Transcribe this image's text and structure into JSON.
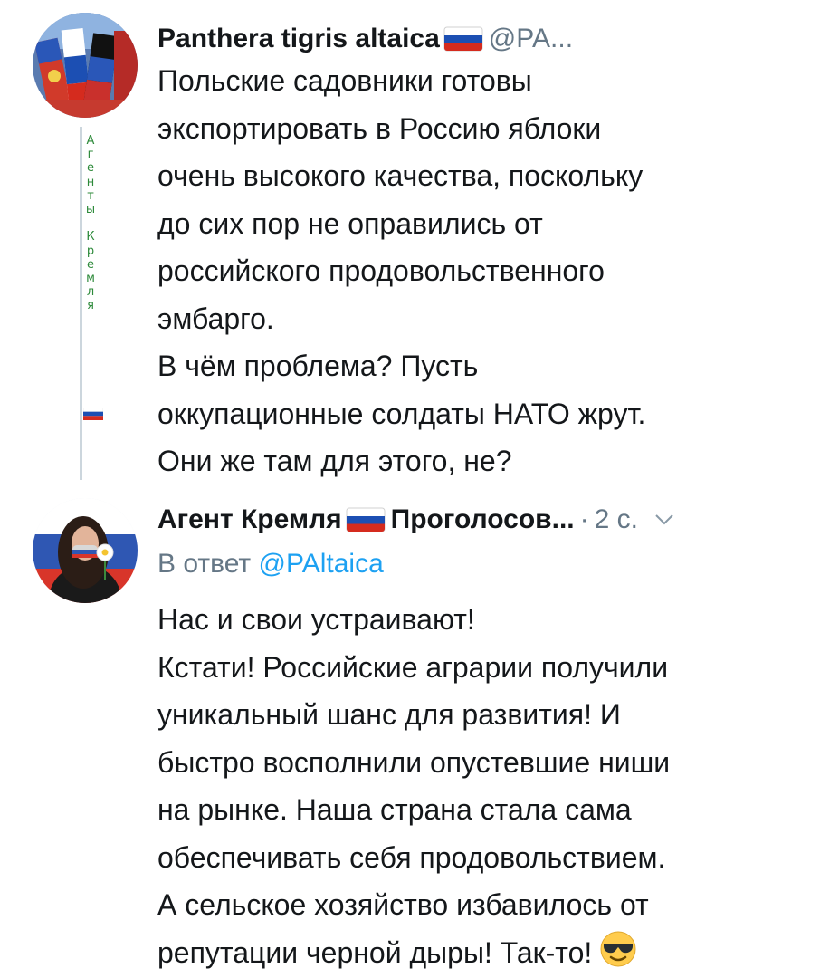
{
  "tweets": [
    {
      "display_name": "Panthera tigris altaica",
      "handle": "@PA...",
      "flag_icon": "russia-flag-icon",
      "avatar_icon": "flags-collage-avatar",
      "thread_note": "А\nг\nе\nн\nт\nы\n\nК\nр\nе\nм\nл\nя",
      "lines": [
        "Польские садовники готовы",
        "экспортировать в Россию яблоки",
        "очень высокого качества, поскольку",
        "до сих пор не оправились от",
        "российского продовольственного",
        "эмбарго.",
        "В чём проблема? Пусть",
        "оккупационные солдаты НАТО жрут.",
        "Они же там для этого, не?"
      ]
    },
    {
      "display_name": "Агент Кремля",
      "name_suffix": "Проголосов...",
      "flag_icon": "russia-flag-icon",
      "avatar_icon": "woman-with-flower-avatar",
      "dot": "·",
      "timestamp": "2 с.",
      "menu_icon": "chevron-down-icon",
      "reply_label": "В ответ",
      "reply_handle": "@PAltaica",
      "lines": [
        "Нас и свои устраивают!",
        "Кстати! Российские аграрии получили",
        "уникальный шанс для развития! И",
        "быстро восполнили опустевшие ниши",
        "на рынке. Наша страна стала сама",
        "обеспечивать себя продовольствием.",
        "А сельское хозяйство избавилось от",
        "репутации черной дыры! Так-то!"
      ],
      "trailing_emoji": "sunglasses-emoji-icon"
    }
  ],
  "colors": {
    "text": "#14171a",
    "secondary": "#657786",
    "link": "#1da1f2",
    "thread_line": "#ccd6dd",
    "note_green": "#2d8a3a"
  }
}
